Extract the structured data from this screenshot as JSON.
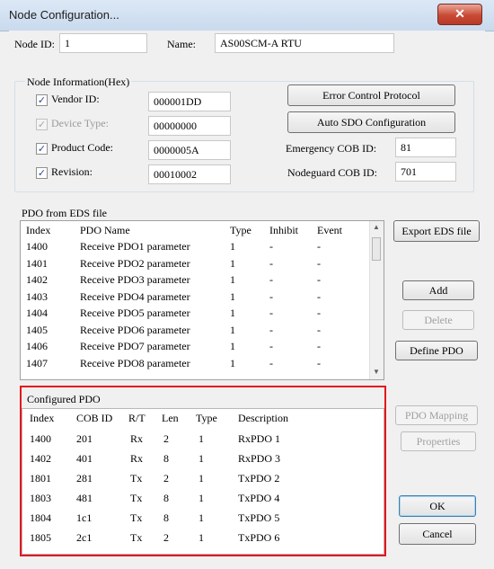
{
  "window": {
    "title": "Node Configuration...",
    "close_label": "✕"
  },
  "node": {
    "id_label": "Node ID:",
    "id_value": "1",
    "name_label": "Name:",
    "name_value": "AS00SCM-A RTU"
  },
  "node_info": {
    "group_label": "Node Information(Hex)",
    "vendor": {
      "label": "Vendor ID:",
      "value": "000001DD",
      "checked": true
    },
    "device_type": {
      "label": "Device Type:",
      "value": "00000000",
      "checked": true
    },
    "product_code": {
      "label": "Product Code:",
      "value": "0000005A",
      "checked": true
    },
    "revision": {
      "label": "Revision:",
      "value": "00010002",
      "checked": true
    }
  },
  "buttons": {
    "error_control": "Error Control Protocol",
    "auto_sdo": "Auto SDO Configuration",
    "export_eds": "Export EDS file",
    "add": "Add",
    "delete": "Delete",
    "define_pdo": "Define PDO",
    "pdo_mapping": "PDO Mapping",
    "properties": "Properties",
    "ok": "OK",
    "cancel": "Cancel"
  },
  "cob": {
    "emergency_label": "Emergency COB ID:",
    "emergency_value": "81",
    "nodeguard_label": "Nodeguard COB ID:",
    "nodeguard_value": "701"
  },
  "pdo_eds": {
    "group_label": "PDO from EDS file",
    "columns": [
      "Index",
      "PDO Name",
      "Type",
      "Inhibit",
      "Event"
    ],
    "rows": [
      [
        "1400",
        "Receive PDO1 parameter",
        "1",
        "-",
        "-"
      ],
      [
        "1401",
        "Receive PDO2 parameter",
        "1",
        "-",
        "-"
      ],
      [
        "1402",
        "Receive PDO3 parameter",
        "1",
        "-",
        "-"
      ],
      [
        "1403",
        "Receive PDO4 parameter",
        "1",
        "-",
        "-"
      ],
      [
        "1404",
        "Receive PDO5 parameter",
        "1",
        "-",
        "-"
      ],
      [
        "1405",
        "Receive PDO6 parameter",
        "1",
        "-",
        "-"
      ],
      [
        "1406",
        "Receive PDO7 parameter",
        "1",
        "-",
        "-"
      ],
      [
        "1407",
        "Receive PDO8 parameter",
        "1",
        "-",
        "-"
      ]
    ]
  },
  "configured": {
    "group_label": "Configured PDO",
    "columns": [
      "Index",
      "COB ID",
      "R/T",
      "Len",
      "Type",
      "Description"
    ],
    "rows": [
      [
        "1400",
        "201",
        "Rx",
        "2",
        "1",
        "RxPDO 1"
      ],
      [
        "1402",
        "401",
        "Rx",
        "8",
        "1",
        "RxPDO 3"
      ],
      [
        "1801",
        "281",
        "Tx",
        "2",
        "1",
        "TxPDO 2"
      ],
      [
        "1803",
        "481",
        "Tx",
        "8",
        "1",
        "TxPDO 4"
      ],
      [
        "1804",
        "1c1",
        "Tx",
        "8",
        "1",
        "TxPDO 5"
      ],
      [
        "1805",
        "2c1",
        "Tx",
        "2",
        "1",
        "TxPDO 6"
      ]
    ]
  },
  "colors": {
    "highlight": "#e3161d",
    "close_button": "#c94a35"
  }
}
